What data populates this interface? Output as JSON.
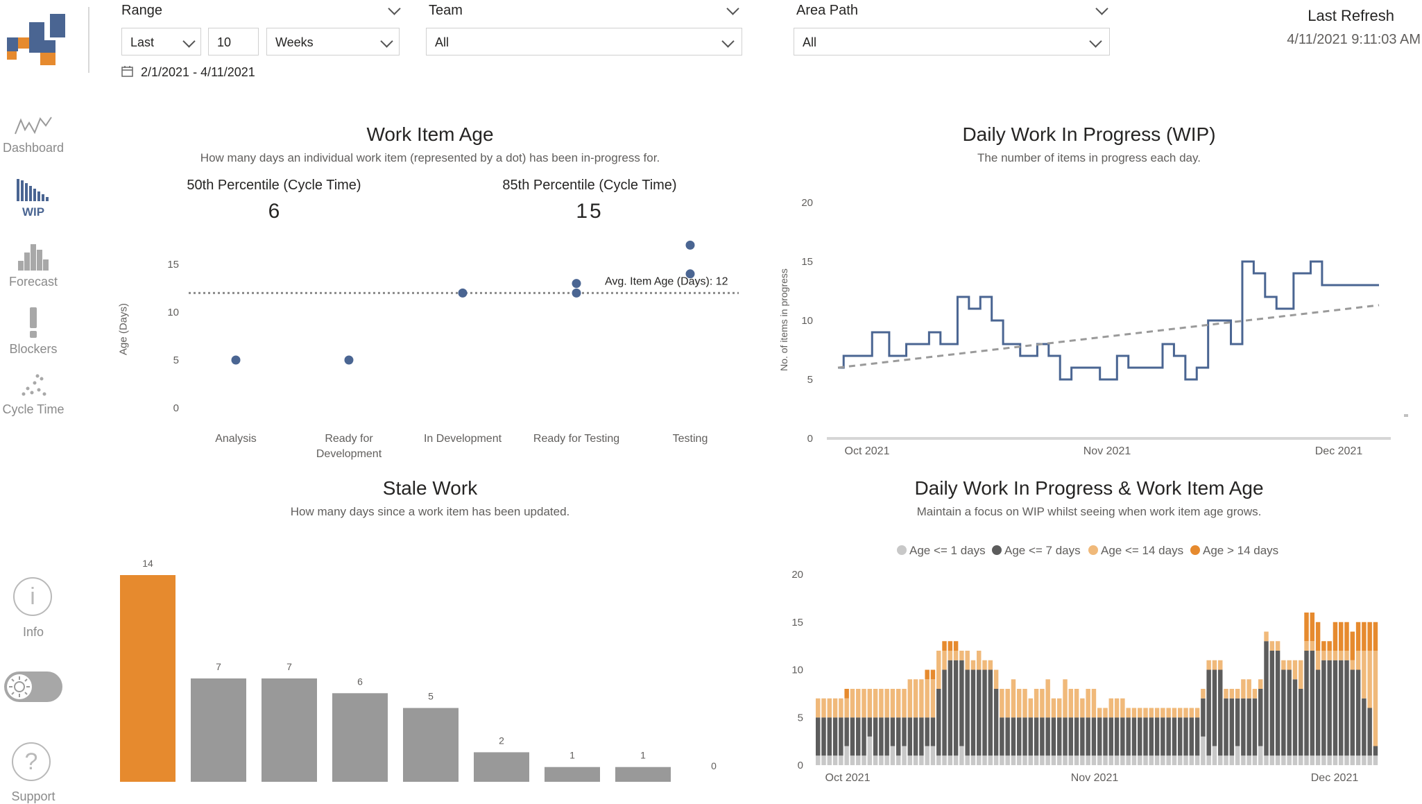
{
  "filters": {
    "range": {
      "label": "Range",
      "mode": "Last",
      "count": "10",
      "unit": "Weeks",
      "date_range": "2/1/2021 - 4/11/2021"
    },
    "team": {
      "label": "Team",
      "value": "All"
    },
    "area_path": {
      "label": "Area Path",
      "value": "All"
    }
  },
  "refresh": {
    "label": "Last Refresh",
    "timestamp": "4/11/2021 9:11:03 AM"
  },
  "nav": {
    "dashboard": "Dashboard",
    "wip": "WIP",
    "forecast": "Forecast",
    "blockers": "Blockers",
    "cycle_time": "Cycle Time",
    "info": "Info",
    "support": "Support"
  },
  "colors": {
    "accent_blue": "#4a6592",
    "orange": "#e68a2e",
    "light_orange": "#f0b97a",
    "dark_gray": "#5c5c5c",
    "light_gray": "#c8c8c8",
    "bar_gray": "#999999"
  },
  "chart_data": [
    {
      "id": "work_item_age",
      "type": "scatter",
      "title": "Work Item Age",
      "subtitle": "How many days an individual work item (represented by a dot) has been in-progress for.",
      "kpis": [
        {
          "label": "50th Percentile (Cycle Time)",
          "value": "6"
        },
        {
          "label": "85th Percentile (Cycle Time)",
          "value": "15"
        }
      ],
      "ylabel": "Age (Days)",
      "ylim": [
        0,
        17
      ],
      "yticks": [
        0,
        5,
        10,
        15
      ],
      "categories": [
        "Analysis",
        "Ready for Development",
        "In Development",
        "Ready for Testing",
        "Testing"
      ],
      "points": [
        {
          "category": "Analysis",
          "y": 5
        },
        {
          "category": "Ready for Development",
          "y": 5
        },
        {
          "category": "In Development",
          "y": 12
        },
        {
          "category": "Ready for Testing",
          "y": 12
        },
        {
          "category": "Ready for Testing",
          "y": 13
        },
        {
          "category": "Testing",
          "y": 14
        },
        {
          "category": "Testing",
          "y": 17
        }
      ],
      "reference_line": {
        "label": "Avg. Item Age (Days): 12",
        "value": 12
      }
    },
    {
      "id": "daily_wip",
      "type": "line",
      "title": "Daily Work In Progress (WIP)",
      "subtitle": "The number of items in progress each day.",
      "ylabel": "No. of items in progress",
      "ylim": [
        0,
        20
      ],
      "yticks": [
        0,
        5,
        10,
        15,
        20
      ],
      "xticks": [
        "Oct 2021",
        "Nov 2021",
        "Dec 2021"
      ],
      "values": [
        6,
        7,
        7,
        7,
        7,
        7,
        9,
        9,
        9,
        7,
        7,
        7,
        8,
        8,
        8,
        8,
        9,
        9,
        8,
        8,
        8,
        12,
        12,
        11,
        11,
        12,
        12,
        10,
        10,
        8,
        8,
        8,
        7,
        7,
        7,
        8,
        8,
        7,
        7,
        5,
        5,
        6,
        6,
        6,
        6,
        6,
        5,
        5,
        5,
        7,
        7,
        6,
        6,
        6,
        6,
        6,
        6,
        8,
        8,
        7,
        7,
        5,
        5,
        6,
        6,
        10,
        10,
        10,
        10,
        8,
        8,
        15,
        15,
        14,
        14,
        12,
        12,
        11,
        11,
        11,
        14,
        14,
        14,
        15,
        15,
        13,
        13,
        13,
        13,
        13,
        13,
        13,
        13,
        13,
        13,
        13
      ],
      "trend": [
        6,
        11.3
      ]
    },
    {
      "id": "stale_work",
      "type": "bar",
      "title": "Stale Work",
      "subtitle": "How many days since a work item has been updated.",
      "values": [
        14,
        7,
        7,
        6,
        5,
        2,
        1,
        1,
        0
      ],
      "highlight_index": 0
    },
    {
      "id": "wip_and_age",
      "type": "bar",
      "stacked": true,
      "title": "Daily Work In Progress & Work Item Age",
      "subtitle": "Maintain a focus on WIP whilst seeing when work item age grows.",
      "ylim": [
        0,
        20
      ],
      "yticks": [
        0,
        5,
        10,
        15,
        20
      ],
      "xticks": [
        "Oct 2021",
        "Nov 2021",
        "Dec 2021"
      ],
      "legend_position": "top",
      "series": [
        {
          "name": "Age <= 1 days",
          "color": "#c8c8c8",
          "values": [
            1,
            1,
            1,
            1,
            1,
            2,
            1,
            1,
            1,
            3,
            1,
            1,
            1,
            2,
            1,
            2,
            1,
            1,
            1,
            2,
            2,
            1,
            1,
            1,
            1,
            2,
            1,
            1,
            1,
            1,
            1,
            1,
            1,
            1,
            1,
            1,
            1,
            1,
            1,
            1,
            1,
            1,
            1,
            1,
            1,
            1,
            1,
            1,
            1,
            1,
            1,
            1,
            1,
            1,
            1,
            1,
            1,
            1,
            1,
            1,
            1,
            1,
            1,
            1,
            1,
            1,
            1,
            3,
            1,
            2,
            1,
            1,
            1,
            2,
            1,
            1,
            1,
            2,
            1,
            1,
            1,
            1,
            1,
            1,
            1,
            1,
            1,
            1,
            1,
            1,
            1,
            1,
            1,
            1,
            1,
            1,
            1,
            1
          ]
        },
        {
          "name": "Age <= 7 days",
          "color": "#5c5c5c",
          "values": [
            4,
            4,
            4,
            4,
            4,
            3,
            4,
            4,
            4,
            2,
            4,
            4,
            4,
            3,
            4,
            3,
            4,
            4,
            4,
            3,
            3,
            7,
            9,
            10,
            10,
            9,
            9,
            9,
            9,
            9,
            9,
            7,
            4,
            4,
            4,
            4,
            4,
            4,
            4,
            4,
            4,
            4,
            4,
            4,
            4,
            4,
            4,
            4,
            4,
            4,
            4,
            4,
            4,
            4,
            4,
            4,
            4,
            4,
            4,
            4,
            4,
            4,
            4,
            4,
            4,
            4,
            4,
            4,
            9,
            8,
            9,
            6,
            6,
            5,
            6,
            6,
            6,
            6,
            12,
            11,
            11,
            9,
            9,
            8,
            7,
            11,
            11,
            9,
            10,
            10,
            10,
            10,
            10,
            9,
            9,
            6,
            5,
            1
          ]
        },
        {
          "name": "Age <= 14 days",
          "color": "#f0b97a",
          "values": [
            2,
            2,
            2,
            2,
            2,
            2,
            3,
            3,
            3,
            3,
            3,
            3,
            3,
            3,
            3,
            3,
            4,
            4,
            4,
            4,
            4,
            4,
            2,
            1,
            1,
            1,
            2,
            1,
            2,
            1,
            1,
            2,
            3,
            3,
            4,
            3,
            3,
            2,
            3,
            3,
            4,
            2,
            2,
            4,
            3,
            3,
            2,
            3,
            3,
            1,
            1,
            2,
            2,
            2,
            1,
            1,
            1,
            1,
            1,
            1,
            1,
            1,
            1,
            1,
            1,
            1,
            1,
            1,
            1,
            1,
            1,
            1,
            1,
            1,
            2,
            2,
            1,
            1,
            1,
            1,
            1,
            1,
            1,
            2,
            3,
            1,
            1,
            2,
            1,
            1,
            1,
            1,
            1,
            1,
            2,
            5,
            6,
            10
          ]
        },
        {
          "name": "Age > 14 days",
          "color": "#e68a2e",
          "values": [
            0,
            0,
            0,
            0,
            0,
            1,
            0,
            0,
            0,
            0,
            0,
            0,
            0,
            0,
            0,
            0,
            0,
            0,
            0,
            1,
            1,
            0,
            1,
            1,
            1,
            0,
            0,
            0,
            0,
            0,
            0,
            0,
            0,
            0,
            0,
            0,
            0,
            0,
            0,
            0,
            0,
            0,
            0,
            0,
            0,
            0,
            0,
            0,
            0,
            0,
            0,
            0,
            0,
            0,
            0,
            0,
            0,
            0,
            0,
            0,
            0,
            0,
            0,
            0,
            0,
            0,
            0,
            0,
            0,
            0,
            0,
            0,
            0,
            0,
            0,
            0,
            0,
            0,
            0,
            0,
            0,
            0,
            0,
            0,
            0,
            3,
            3,
            3,
            1,
            1,
            3,
            3,
            3,
            3,
            3,
            3,
            3,
            3
          ]
        }
      ]
    }
  ]
}
